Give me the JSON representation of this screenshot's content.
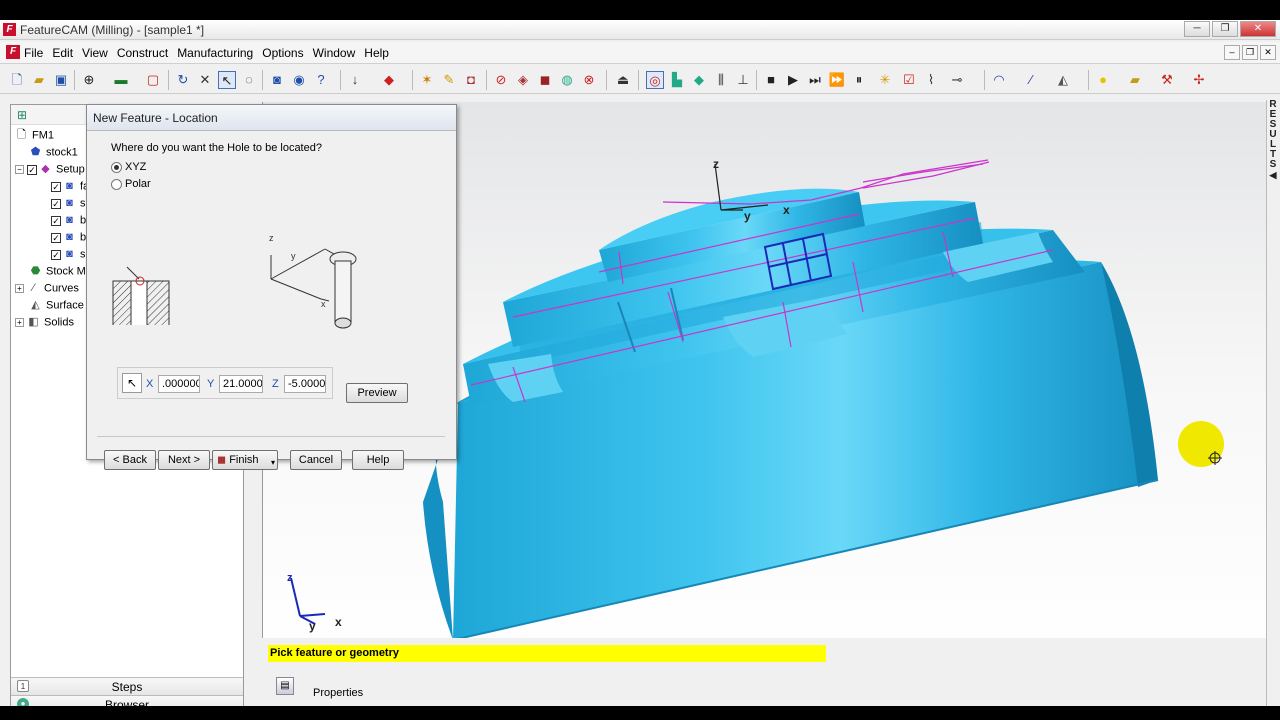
{
  "window": {
    "title": "FeatureCAM (Milling) - [sample1 *]",
    "app_icon": "F",
    "controls": [
      "─",
      "❐",
      "✕"
    ],
    "mdi_controls": [
      "–",
      "❐",
      "✕"
    ]
  },
  "menu": {
    "items": [
      "File",
      "Edit",
      "View",
      "Construct",
      "Manufacturing",
      "Options",
      "Window",
      "Help"
    ]
  },
  "browser": {
    "tree": [
      {
        "label": "FM1",
        "icon": "document-icon"
      },
      {
        "label": "stock1",
        "icon": "stock-icon"
      },
      {
        "label": "Setup",
        "icon": "setup-icon"
      },
      {
        "label": "fa",
        "icon": "feature-icon"
      },
      {
        "label": "si",
        "icon": "feature-icon"
      },
      {
        "label": "bi",
        "icon": "feature-icon"
      },
      {
        "label": "bi",
        "icon": "feature-icon"
      },
      {
        "label": "si",
        "icon": "feature-icon"
      },
      {
        "label": "Stock M",
        "icon": "stock-model-icon"
      },
      {
        "label": "Curves",
        "icon": "curve-icon"
      },
      {
        "label": "Surface",
        "icon": "surface-icon"
      },
      {
        "label": "Solids",
        "icon": "solid-icon"
      }
    ],
    "tabs": [
      "Steps",
      "Browser"
    ]
  },
  "dialog": {
    "title": "New Feature - Location",
    "question": "Where do you want the Hole to be located?",
    "options": [
      "XYZ",
      "Polar"
    ],
    "selected_option": "XYZ",
    "coords": {
      "x_label": "X",
      "x_value": ".000000",
      "y_label": "Y",
      "y_value": "21.0000",
      "z_label": "Z",
      "z_value": "-5.0000("
    },
    "preview_label": "Preview",
    "buttons": {
      "back": "< Back",
      "next": "Next >",
      "finish": "Finish",
      "cancel": "Cancel",
      "help": "Help"
    }
  },
  "viewport": {
    "axis_labels": {
      "z": "z",
      "y": "y",
      "x": "x"
    },
    "part_color": "#29aee0",
    "toolpath_color": "#cc33cc",
    "feature_outline_color": "#1a2ab8",
    "highlight_color": "#f0e800"
  },
  "results_strip": "RESULTS",
  "status": {
    "message": "Pick feature or geometry",
    "properties_label": "Properties"
  }
}
